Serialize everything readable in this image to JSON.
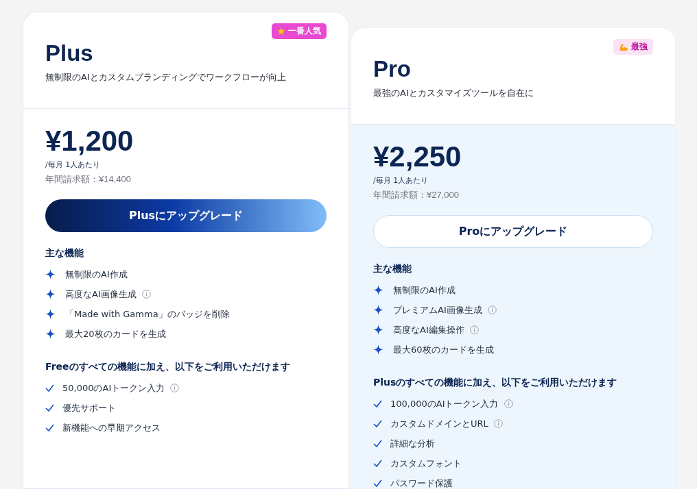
{
  "plans": [
    {
      "name": "Plus",
      "tagline": "無制限のAIとカスタムブランディングでワークフローが向上",
      "badge": "一番人気",
      "price": "¥1,200",
      "per": "/毎月 1人あたり",
      "annual": "年間請求額：¥14,400",
      "button": "Plusにアップグレード",
      "features_heading": "主な機能",
      "features": [
        {
          "text": "無制限のAI作成",
          "info": false
        },
        {
          "text": "高度なAI画像生成",
          "info": true
        },
        {
          "text": "「Made with Gamma」のバッジを削除",
          "info": false
        },
        {
          "text": "最大20枚のカードを生成",
          "info": false
        }
      ],
      "extras_heading": "Freeのすべての機能に加え、以下をご利用いただけます",
      "extras": [
        {
          "text": "50,000のAIトークン入力",
          "info": true
        },
        {
          "text": "優先サポート",
          "info": false
        },
        {
          "text": "新機能への早期アクセス",
          "info": false
        }
      ]
    },
    {
      "name": "Pro",
      "tagline": "最強のAIとカスタマイズツールを自在に",
      "badge": "最強",
      "price": "¥2,250",
      "per": "/毎月 1人あたり",
      "annual": "年間請求額：¥27,000",
      "button": "Proにアップグレード",
      "features_heading": "主な機能",
      "features": [
        {
          "text": "無制限のAI作成",
          "info": false
        },
        {
          "text": "プレミアムAI画像生成",
          "info": true
        },
        {
          "text": "高度なAI編集操作",
          "info": true
        },
        {
          "text": "最大60枚のカードを生成",
          "info": false
        }
      ],
      "extras_heading": "Plusのすべての機能に加え、以下をご利用いただけます",
      "extras": [
        {
          "text": "100,000のAIトークン入力",
          "info": true
        },
        {
          "text": "カスタムドメインとURL",
          "info": true
        },
        {
          "text": "詳細な分析",
          "info": false
        },
        {
          "text": "カスタムフォント",
          "info": false
        },
        {
          "text": "パスワード保護",
          "info": false
        }
      ]
    }
  ]
}
